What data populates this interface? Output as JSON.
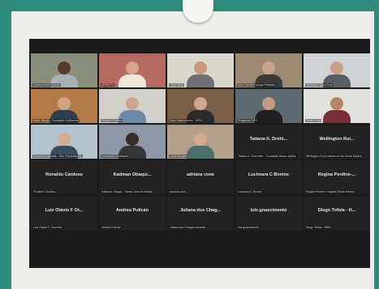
{
  "participants": [
    {
      "video": true,
      "active": true,
      "bg": "#8a8f7c",
      "skin": "#5b3a2a",
      "shirt": "#a7b0b5",
      "label": "Andrea Aneth Marina"
    },
    {
      "video": true,
      "bg": "#b56a62",
      "skin": "#d8a487",
      "shirt": "#f0e6dc",
      "label": "ARRIETA"
    },
    {
      "video": true,
      "bg": "#d9d6cc",
      "skin": "#c69a7a",
      "shirt": "#6d6f75",
      "label": "Fabio Bruti"
    },
    {
      "video": true,
      "bg": "#9c8a72",
      "skin": "#c9a488",
      "shirt": "#3b3b3b",
      "label": "Ana Carolina Dengo Pimentel"
    },
    {
      "video": true,
      "bg": "#cfd3d6",
      "skin": "#c7a187",
      "shirt": "#5a5f66",
      "label": "Alexandre Brito Cruz"
    },
    {
      "video": true,
      "bg": "#b47a45",
      "skin": "#d2a583",
      "shirt": "#2f3e4f",
      "label": "Mario Sérgio - Fundação Guilherme"
    },
    {
      "video": true,
      "bg": "#d2d0cb",
      "skin": "#cda58c",
      "shirt": "#6b88a6",
      "label": "Roberto Oliveira"
    },
    {
      "video": true,
      "bg": "#7a6048",
      "skin": "#d0a68d",
      "shirt": "#2b2b2b",
      "label": "Allan Vasconcelos - UFRJ"
    },
    {
      "video": true,
      "bg": "#5d6b70",
      "skin": "#c49b80",
      "shirt": "#1f1f1f",
      "label": "Programa IUPS"
    },
    {
      "video": true,
      "bg": "#e0e0dc",
      "skin": "#b78466",
      "shirt": "#7a2e35",
      "label": "Daniel Lima"
    },
    {
      "video": true,
      "bg": "#b3c4cf",
      "skin": "#d2ab91",
      "shirt": "#3d4a5a",
      "label": "Fernanda Miranda - Sec. Florianópolis"
    },
    {
      "video": true,
      "bg": "#8d97a6",
      "skin": "#3a2b25",
      "shirt": "#353535",
      "label": "Conceição Rodrigues"
    },
    {
      "video": true,
      "bg": "#b2a08a",
      "skin": "#d3aa8c",
      "shirt": "#4a6f6a",
      "label": "Carla Borges"
    },
    {
      "video": false,
      "name": "Tatiana K. Dreht...",
      "label": "Tatiana K. Drechsler - Fundação Banco Ações"
    },
    {
      "video": false,
      "name": "Wellington Rui...",
      "label": "Wellington Rui Andrade de Sá Santa Marina"
    },
    {
      "video": false,
      "name": "Ronaldo Cardoso",
      "label": "Ronaldo Cardoso"
    },
    {
      "video": false,
      "name": "Kadman Obaqui...",
      "label": "Kadman Obaqui - Santa Casa de Marília"
    },
    {
      "video": false,
      "name": "adriana cone",
      "label": "adriana cone"
    },
    {
      "video": false,
      "name": "Lucimara C Bonine",
      "label": "Lucimara C Bonine"
    },
    {
      "video": false,
      "name": "Regina Perdine-...",
      "label": "Regina Perdine Hospital Santa Marina"
    },
    {
      "video": false,
      "name": "Luiz Otávio F Or...",
      "label": "Luiz Otávio F Cravinho"
    },
    {
      "video": false,
      "name": "Andrea Pulicán",
      "label": "Andrea Pulicán"
    },
    {
      "video": false,
      "name": "Juliana dos Chag...",
      "label": "Juliana dos Chagas Almeida"
    },
    {
      "video": false,
      "name": "luiz.gnascimento",
      "label": "luiz.gnascimento"
    },
    {
      "video": false,
      "name": "Diego Tofoia - H...",
      "label": "Diego Tofoia - HMS"
    }
  ]
}
